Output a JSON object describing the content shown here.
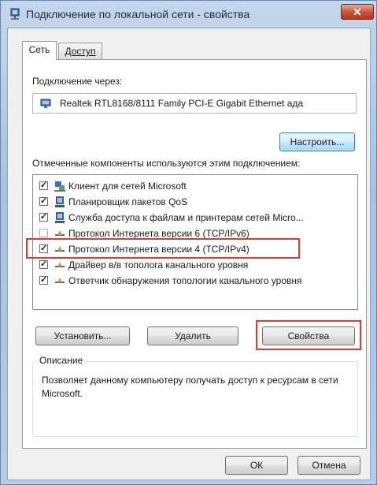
{
  "window": {
    "title": "Подключение по локальной сети - свойства",
    "close_label": "✕"
  },
  "tabs": [
    {
      "label": "Сеть",
      "active": true
    },
    {
      "label": "Доступ",
      "active": false
    }
  ],
  "connect_using": {
    "label": "Подключение через:",
    "adapter": "Realtek RTL8168/8111 Family PCI-E Gigabit Ethernet ада",
    "configure_label": "Настроить..."
  },
  "components": {
    "label": "Отмеченные компоненты используются этим подключением:",
    "items": [
      {
        "label": "Клиент для сетей Microsoft",
        "checked": true,
        "icon": "network-client-icon"
      },
      {
        "label": "Планировщик пакетов QoS",
        "checked": true,
        "icon": "network-service-icon"
      },
      {
        "label": "Служба доступа к файлам и принтерам сетей Micro...",
        "checked": true,
        "icon": "network-service-icon"
      },
      {
        "label": "Протокол Интернета версии 6 (TCP/IPv6)",
        "checked": false,
        "icon": "protocol-icon"
      },
      {
        "label": "Протокол Интернета версии 4 (TCP/IPv4)",
        "checked": true,
        "icon": "protocol-icon"
      },
      {
        "label": "Драйвер в/в тополога канального уровня",
        "checked": true,
        "icon": "protocol-icon"
      },
      {
        "label": "Ответчик обнаружения топологии канального уровня",
        "checked": true,
        "icon": "protocol-icon"
      }
    ]
  },
  "buttons": {
    "install": "Установить...",
    "uninstall": "Удалить",
    "properties": "Свойства",
    "ok": "ОК",
    "cancel": "Отмена"
  },
  "description": {
    "legend": "Описание",
    "text": "Позволяет данному компьютеру получать доступ к ресурсам в сети Microsoft."
  },
  "colors": {
    "highlight": "#e23a2e",
    "window_frame": "#a9c1dd"
  }
}
